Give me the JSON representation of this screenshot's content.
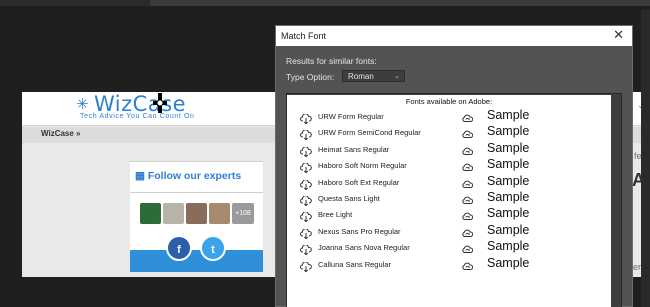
{
  "webpage": {
    "logo_text": "WizCase",
    "logo_tagline": "Tech Advice You Can Count On",
    "breadcrumb": "WizCase »",
    "experts_title": "Follow our experts",
    "experts_more": "+108",
    "facebook": "f",
    "twitter": "t",
    "right_nav": "s",
    "right_fees": "fees",
    "right_heading": "An",
    "right_footer": "ers,"
  },
  "dialog": {
    "title": "Match Font",
    "close": "✕",
    "results_label": "Results for similar fonts:",
    "type_label": "Type Option:",
    "type_value": "Roman",
    "list_header": "Fonts available on Adobe:",
    "fonts": [
      {
        "name": "URW Form Regular",
        "sample": "Sample"
      },
      {
        "name": "URW Form SemiCond Regular",
        "sample": "Sample"
      },
      {
        "name": "Heimat Sans Regular",
        "sample": "Sample"
      },
      {
        "name": "Haboro Soft Norm Regular",
        "sample": "Sample"
      },
      {
        "name": "Haboro Soft Ext Regular",
        "sample": "Sample"
      },
      {
        "name": "Questa Sans Light",
        "sample": "Sample"
      },
      {
        "name": "Bree Light",
        "sample": "Sample"
      },
      {
        "name": "Nexus Sans Pro Regular",
        "sample": "Sample"
      },
      {
        "name": "Joanna Sans Nova Regular",
        "sample": "Sample"
      },
      {
        "name": "Calluna Sans Regular",
        "sample": "Sample"
      }
    ]
  },
  "icons": {
    "download": "cloud-download-icon",
    "sync": "cloud-sync-icon",
    "calendar": "calendar-icon"
  },
  "colors": {
    "accent": "#2f7fd0",
    "dialog_bg": "#535353",
    "twitter": "#3aa4e8",
    "facebook": "#2d5fa8"
  }
}
